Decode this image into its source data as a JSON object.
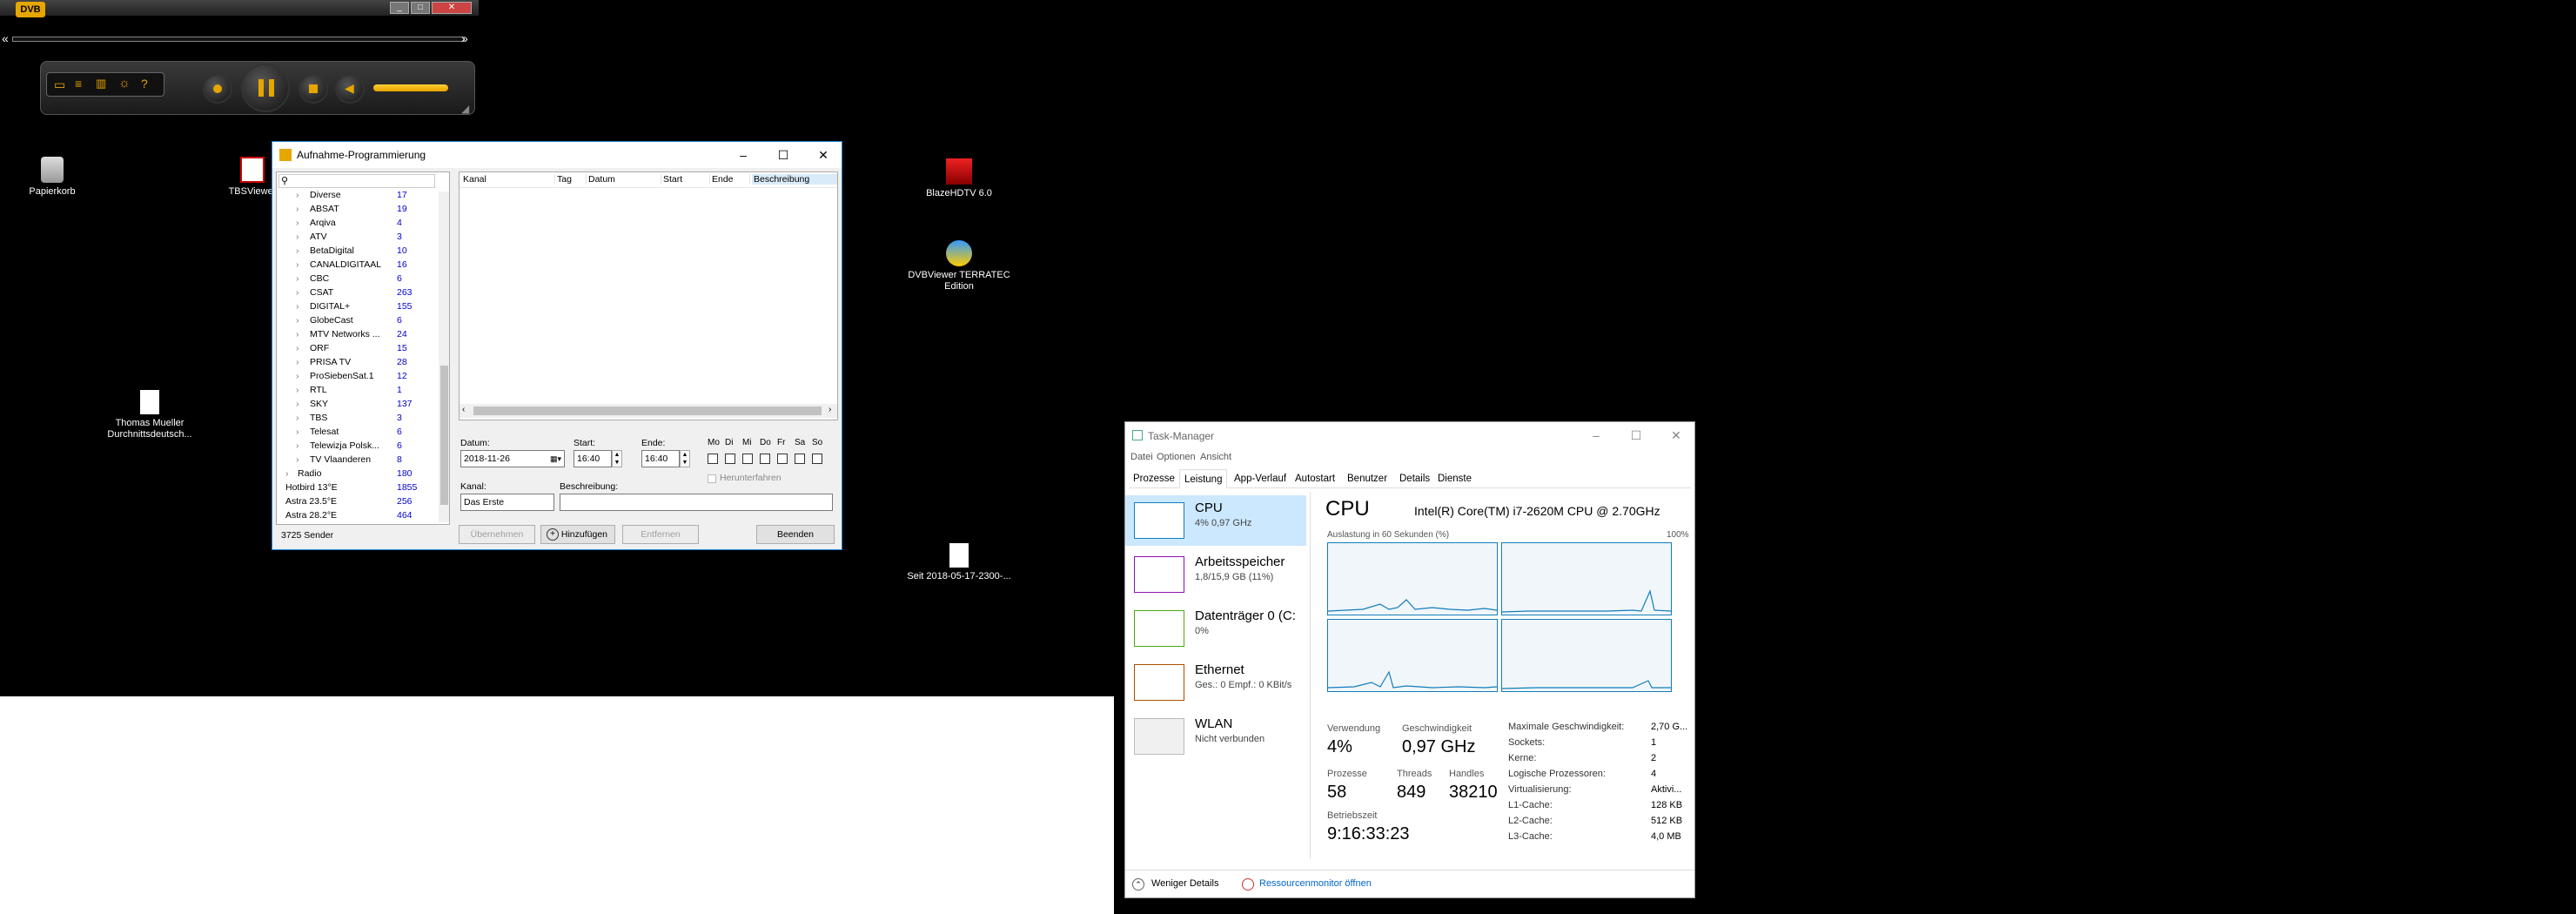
{
  "desktop1": {
    "icons": [
      {
        "name": "recycle-bin",
        "label": "Papierkorb"
      },
      {
        "name": "tbsviewer",
        "label": "TBSViewer"
      },
      {
        "name": "doc",
        "label": "Thomas Mueller Durchnittsdeutsch..."
      }
    ]
  },
  "desktop2_icons": [
    {
      "label": "BlazeHDTV 6.0"
    },
    {
      "label": "DVBViewer TERRATEC Edition"
    },
    {
      "label": "Seit 2018-05-17-2300-..."
    }
  ],
  "player": {
    "logo": "DVB"
  },
  "rec_dialog": {
    "title": "Aufnahme-Programmierung",
    "search_placeholder": "",
    "channels": [
      {
        "name": "Diverse",
        "count": "17",
        "indent": true
      },
      {
        "name": "ABSAT",
        "count": "19",
        "indent": true
      },
      {
        "name": "Arqiva",
        "count": "4",
        "indent": true
      },
      {
        "name": "ATV",
        "count": "3",
        "indent": true
      },
      {
        "name": "BetaDigital",
        "count": "10",
        "indent": true
      },
      {
        "name": "CANALDIGITAAL",
        "count": "16",
        "indent": true
      },
      {
        "name": "CBC",
        "count": "6",
        "indent": true
      },
      {
        "name": "CSAT",
        "count": "263",
        "indent": true
      },
      {
        "name": "DIGITAL+",
        "count": "155",
        "indent": true
      },
      {
        "name": "GlobeCast",
        "count": "6",
        "indent": true
      },
      {
        "name": "MTV Networks ...",
        "count": "24",
        "indent": true
      },
      {
        "name": "ORF",
        "count": "15",
        "indent": true
      },
      {
        "name": "PRISA TV",
        "count": "28",
        "indent": true
      },
      {
        "name": "ProSiebenSat.1",
        "count": "12",
        "indent": true
      },
      {
        "name": "RTL",
        "count": "1",
        "indent": true
      },
      {
        "name": "SKY",
        "count": "137",
        "indent": true
      },
      {
        "name": "TBS",
        "count": "3",
        "indent": true
      },
      {
        "name": "Telesat",
        "count": "6",
        "indent": true
      },
      {
        "name": "Telewizja Polsk...",
        "count": "6",
        "indent": true
      },
      {
        "name": "TV Vlaanderen",
        "count": "8",
        "indent": true
      },
      {
        "name": "Radio",
        "count": "180",
        "indent": false
      },
      {
        "name": "Hotbird 13°E",
        "count": "1855",
        "indent": false
      },
      {
        "name": "Astra 23.5°E",
        "count": "256",
        "indent": false
      },
      {
        "name": "Astra 28.2°E",
        "count": "464",
        "indent": false
      }
    ],
    "status": "3725 Sender",
    "columns": [
      "Kanal",
      "Tag",
      "Datum",
      "Start",
      "Ende",
      "Beschreibung"
    ],
    "labels": {
      "datum": "Datum:",
      "start": "Start:",
      "ende": "Ende:",
      "kanal": "Kanal:",
      "beschreibung": "Beschreibung:",
      "herunterfahren": "Herunterfahren"
    },
    "values": {
      "datum": "2018-11-26",
      "start": "16:40",
      "ende": "16:40",
      "kanal": "Das Erste",
      "beschreibung": ""
    },
    "days": [
      "Mo",
      "Di",
      "Mi",
      "Do",
      "Fr",
      "Sa",
      "So"
    ],
    "buttons": {
      "uebernehmen": "Übernehmen",
      "hinzufuegen": "Hinzufügen",
      "entfernen": "Entfernen",
      "beenden": "Beenden"
    }
  },
  "taskmgr": {
    "title": "Task-Manager",
    "menu": [
      "Datei",
      "Optionen",
      "Ansicht"
    ],
    "tabs": [
      "Prozesse",
      "Leistung",
      "App-Verlauf",
      "Autostart",
      "Benutzer",
      "Details",
      "Dienste"
    ],
    "active_tab": "Leistung",
    "side": [
      {
        "title": "CPU",
        "sub": "4% 0,97 GHz"
      },
      {
        "title": "Arbeitsspeicher",
        "sub": "1,8/15,9 GB (11%)"
      },
      {
        "title": "Datenträger 0 (C:",
        "sub": "0%"
      },
      {
        "title": "Ethernet",
        "sub": "Ges.: 0 Empf.: 0 KBit/s"
      },
      {
        "title": "WLAN",
        "sub": "Nicht verbunden"
      }
    ],
    "cpu_title": "CPU",
    "cpu_model": "Intel(R) Core(TM) i7-2620M CPU @ 2.70GHz",
    "graph_label": "Auslastung in 60 Sekunden (%)",
    "graph_max": "100%",
    "stats": {
      "verwendung_l": "Verwendung",
      "verwendung": "4%",
      "geschw_l": "Geschwindigkeit",
      "geschw": "0,97 GHz",
      "prozesse_l": "Prozesse",
      "prozesse": "58",
      "threads_l": "Threads",
      "threads": "849",
      "handles_l": "Handles",
      "handles": "38210",
      "betrieb_l": "Betriebszeit",
      "betrieb": "9:16:33:23"
    },
    "details": [
      {
        "k": "Maximale Geschwindigkeit:",
        "v": "2,70 G..."
      },
      {
        "k": "Sockets:",
        "v": "1"
      },
      {
        "k": "Kerne:",
        "v": "2"
      },
      {
        "k": "Logische Prozessoren:",
        "v": "4"
      },
      {
        "k": "Virtualisierung:",
        "v": "Aktivi..."
      },
      {
        "k": "L1-Cache:",
        "v": "128 KB"
      },
      {
        "k": "L2-Cache:",
        "v": "512 KB"
      },
      {
        "k": "L3-Cache:",
        "v": "4,0 MB"
      }
    ],
    "footer_less": "Weniger Details",
    "footer_monitor": "Ressourcenmonitor öffnen"
  }
}
